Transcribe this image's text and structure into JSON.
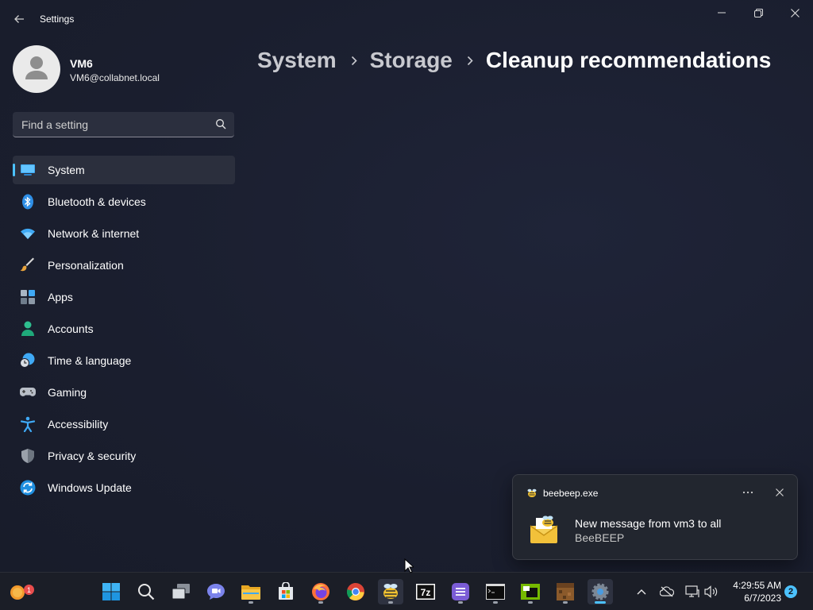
{
  "window": {
    "app_title": "Settings"
  },
  "profile": {
    "name": "VM6",
    "email": "VM6@collabnet.local"
  },
  "search": {
    "placeholder": "Find a setting"
  },
  "nav": {
    "items": [
      {
        "label": "System",
        "icon": "system-icon",
        "active": true
      },
      {
        "label": "Bluetooth & devices",
        "icon": "bluetooth-icon"
      },
      {
        "label": "Network & internet",
        "icon": "wifi-icon"
      },
      {
        "label": "Personalization",
        "icon": "brush-icon"
      },
      {
        "label": "Apps",
        "icon": "apps-icon"
      },
      {
        "label": "Accounts",
        "icon": "person-icon"
      },
      {
        "label": "Time & language",
        "icon": "clock-globe-icon"
      },
      {
        "label": "Gaming",
        "icon": "gamepad-icon"
      },
      {
        "label": "Accessibility",
        "icon": "accessibility-icon"
      },
      {
        "label": "Privacy & security",
        "icon": "shield-icon"
      },
      {
        "label": "Windows Update",
        "icon": "update-icon"
      }
    ]
  },
  "breadcrumb": {
    "items": [
      "System",
      "Storage",
      "Cleanup recommendations"
    ]
  },
  "toast": {
    "app_name": "beebeep.exe",
    "title": "New message from vm3 to all",
    "body": "BeeBEEP"
  },
  "taskbar": {
    "weather_badge": "1",
    "apps": [
      "start-icon",
      "search-icon",
      "task-view-icon",
      "chat-icon",
      "file-explorer-icon",
      "store-icon",
      "firefox-icon",
      "chrome-icon",
      "beebeep-icon",
      "7zip-icon",
      "notes-icon",
      "terminal-icon",
      "nvidia-icon",
      "minecraft-icon",
      "settings-icon"
    ],
    "clock_time": "4:29:55 AM",
    "clock_date": "6/7/2023",
    "notification_count": "2"
  },
  "colors": {
    "accent": "#4cc2ff",
    "background": "#1a1e2e",
    "sidebar_active": "#2b2f3d"
  }
}
